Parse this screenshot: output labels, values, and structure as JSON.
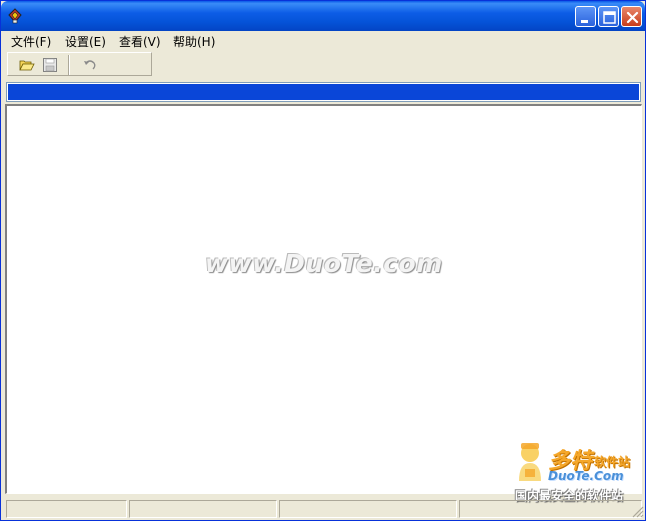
{
  "window": {
    "title": "",
    "app_icon": "app-icon",
    "controls": {
      "minimize_icon": "minimize-icon",
      "maximize_icon": "maximize-icon",
      "close_icon": "close-icon"
    },
    "accent_color": "#0a46d8"
  },
  "menubar": {
    "items": [
      {
        "label": "文件(F)"
      },
      {
        "label": "设置(E)"
      },
      {
        "label": "查看(V)"
      },
      {
        "label": "帮助(H)"
      }
    ]
  },
  "toolbar": {
    "buttons": [
      {
        "icon": "folder-open-icon"
      },
      {
        "icon": "save-icon"
      },
      {
        "icon": "undo-icon"
      }
    ]
  },
  "content": {
    "watermark": "www.DuoTe.com"
  },
  "logo": {
    "brand": "多特",
    "brand_suffix": "软件站",
    "url": "DuoTe.Com",
    "slogan": "国内最安全的软件站"
  },
  "statusbar": {
    "panes": [
      "",
      "",
      "",
      ""
    ]
  }
}
